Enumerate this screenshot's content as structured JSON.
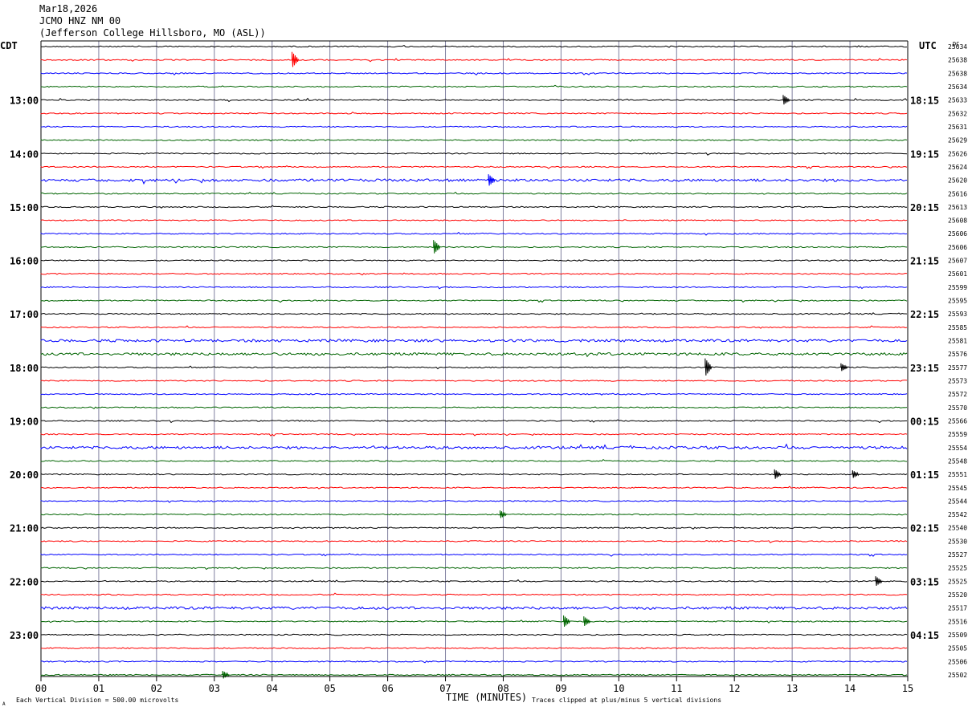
{
  "header": {
    "date": "Mar18,2026",
    "station": "JCMO HNZ NM 00",
    "location": "(Jefferson College Hillsboro, MO (ASL))"
  },
  "labels": {
    "left_tz": "CDT",
    "right_tz": "UTC",
    "dc": "DC"
  },
  "footer": {
    "scale": "Each Vertical Division =  500.00 microvolts",
    "clip": "Traces clipped at plus/minus 5 vertical divisions",
    "corner": "A"
  },
  "colors": {
    "trace_cycle": [
      "#000000",
      "#ff0000",
      "#0000ff",
      "#006400"
    ],
    "grid_vertical": "#7f7f9f",
    "axis": "#000000"
  },
  "chart_data": {
    "type": "line",
    "title": "",
    "xlabel": "TIME (MINUTES)",
    "ylabel": "",
    "xlim": [
      0,
      15
    ],
    "x_ticks": [
      "00",
      "01",
      "02",
      "03",
      "04",
      "05",
      "06",
      "07",
      "08",
      "09",
      "10",
      "11",
      "12",
      "13",
      "14",
      "15"
    ],
    "row_count": 48,
    "row_minutes": 15,
    "left_hour_labels": [
      {
        "row": 4,
        "label": "13:00"
      },
      {
        "row": 8,
        "label": "14:00"
      },
      {
        "row": 12,
        "label": "15:00"
      },
      {
        "row": 16,
        "label": "16:00"
      },
      {
        "row": 20,
        "label": "17:00"
      },
      {
        "row": 24,
        "label": "18:00"
      },
      {
        "row": 28,
        "label": "19:00"
      },
      {
        "row": 32,
        "label": "20:00"
      },
      {
        "row": 36,
        "label": "21:00"
      },
      {
        "row": 40,
        "label": "22:00"
      },
      {
        "row": 44,
        "label": "23:00"
      }
    ],
    "right_hour_labels": [
      {
        "row": 4,
        "label": "18:15"
      },
      {
        "row": 8,
        "label": "19:15"
      },
      {
        "row": 12,
        "label": "20:15"
      },
      {
        "row": 16,
        "label": "21:15"
      },
      {
        "row": 20,
        "label": "22:15"
      },
      {
        "row": 24,
        "label": "23:15"
      },
      {
        "row": 28,
        "label": "00:15"
      },
      {
        "row": 32,
        "label": "01:15"
      },
      {
        "row": 36,
        "label": "02:15"
      },
      {
        "row": 40,
        "label": "03:15"
      },
      {
        "row": 44,
        "label": "04:15"
      }
    ],
    "dc_values": [
      "25634",
      "25638",
      "25638",
      "25634",
      "25633",
      "25632",
      "25631",
      "25629",
      "25626",
      "25624",
      "25620",
      "25616",
      "25613",
      "25608",
      "25606",
      "25606",
      "25607",
      "25601",
      "25599",
      "25595",
      "25593",
      "25585",
      "25581",
      "25576",
      "25577",
      "25573",
      "25572",
      "25570",
      "25566",
      "25559",
      "25554",
      "25548",
      "25551",
      "25545",
      "25544",
      "25542",
      "25540",
      "25530",
      "25527",
      "25525",
      "25525",
      "25520",
      "25517",
      "25516",
      "25509",
      "25505",
      "25506",
      "25502"
    ],
    "noise_rows": [
      10,
      22,
      23,
      30,
      42
    ],
    "events": [
      {
        "row": 1,
        "minute": 4.4,
        "amplitude": 0.8
      },
      {
        "row": 4,
        "minute": 12.9,
        "amplitude": 0.5
      },
      {
        "row": 10,
        "minute": 7.8,
        "amplitude": 0.6
      },
      {
        "row": 15,
        "minute": 6.85,
        "amplitude": 0.7
      },
      {
        "row": 24,
        "minute": 11.55,
        "amplitude": 0.9
      },
      {
        "row": 24,
        "minute": 13.9,
        "amplitude": 0.4
      },
      {
        "row": 32,
        "minute": 12.75,
        "amplitude": 0.5
      },
      {
        "row": 32,
        "minute": 14.1,
        "amplitude": 0.4
      },
      {
        "row": 35,
        "minute": 8.0,
        "amplitude": 0.4
      },
      {
        "row": 40,
        "minute": 14.5,
        "amplitude": 0.5
      },
      {
        "row": 43,
        "minute": 9.1,
        "amplitude": 0.6
      },
      {
        "row": 43,
        "minute": 9.45,
        "amplitude": 0.5
      },
      {
        "row": 47,
        "minute": 3.2,
        "amplitude": 0.4
      }
    ]
  }
}
